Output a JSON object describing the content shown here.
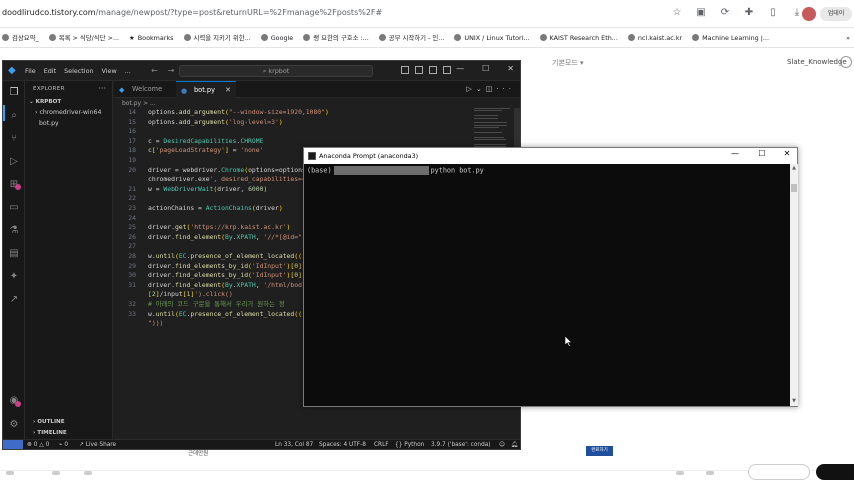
{
  "browser": {
    "url_host": "doodlirudco.tistory.com",
    "url_path": "/manage/newpost/?type=post&returnURL=%2Fmanage%2Fposts%2F#",
    "profile_label": "업데이",
    "bookmarks": [
      "검상요약_",
      "목록 > 식당/식단 >...",
      "Bookmarks",
      "시력을 지키기 위한...",
      "Google",
      "랭 요한의 구호소 :...",
      "공부 시작하기 - 인...",
      "UNIX / Linux Tutori...",
      "KAIST Research Eth...",
      "ncl.kaist.ac.kr",
      "Machine Learning |..."
    ]
  },
  "page": {
    "menu_label": "기본모드 ▾",
    "right_label": "Slate_Knowledge",
    "bottom_label": "근데만원",
    "blue_button": "완료하기"
  },
  "vscode": {
    "menu": [
      "File",
      "Edit",
      "Selection",
      "View",
      "..."
    ],
    "search_text": "krpbot",
    "explorer_title": "EXPLORER",
    "project": "KRPBOT",
    "folder": "chromedriver-win64",
    "file": "bot.py",
    "outline": "OUTLINE",
    "timeline": "TIMELINE",
    "tabs": [
      {
        "label": "Welcome",
        "active": false
      },
      {
        "label": "bot.py",
        "active": true
      }
    ],
    "breadcrumb": "bot.py > ...",
    "status": {
      "errors": "0",
      "warnings": "0",
      "ports": "0",
      "liveshare": "Live Share",
      "position": "Ln 33, Col 87",
      "spaces": "Spaces: 4",
      "encoding": "UTF-8",
      "eol": "CRLF",
      "language": "Python",
      "interpreter": "3.9.7 ('base': conda)"
    }
  },
  "code_lines": [
    {
      "n": "14",
      "text": "options.add_argument(\"--window-size=1920,1080\")"
    },
    {
      "n": "15",
      "text": "options.add_argument('log-level=3')"
    },
    {
      "n": "16",
      "text": ""
    },
    {
      "n": "17",
      "text": "c = DesiredCapabilities.CHROME"
    },
    {
      "n": "18",
      "text": "c['pageLoadStrategy'] = 'none'"
    },
    {
      "n": "19",
      "text": ""
    },
    {
      "n": "20",
      "text": "driver = webdriver.Chrome(options=options"
    },
    {
      "n": "",
      "text": "chromedriver.exe', desired_capabilities=c"
    },
    {
      "n": "21",
      "text": "w = WebDriverWait(driver, 6000)"
    },
    {
      "n": "22",
      "text": ""
    },
    {
      "n": "23",
      "text": "actionChains = ActionChains(driver)"
    },
    {
      "n": "24",
      "text": ""
    },
    {
      "n": "25",
      "text": "driver.get('https://krp.kaist.ac.kr')"
    },
    {
      "n": "26",
      "text": "driver.find_element(By.XPATH, '//*[@id=\""
    },
    {
      "n": "27",
      "text": ""
    },
    {
      "n": "28",
      "text": "w.until(EC.presence_of_element_located(("
    },
    {
      "n": "29",
      "text": "driver.find_elements_by_id('IdInput')[0]"
    },
    {
      "n": "30",
      "text": "driver.find_elements_by_id('IdInput')[0]"
    },
    {
      "n": "31",
      "text": "driver.find_element(By.XPATH, '/html/bod"
    },
    {
      "n": "",
      "text": "[2]/input[1]').click()"
    },
    {
      "n": "32",
      "text": "# 아래의 코드 구문을 통해서 우리가 원하는 정"
    },
    {
      "n": "33",
      "text": "w.until(EC.presence_of_element_located(("
    },
    {
      "n": "",
      "text": "\")))"
    }
  ],
  "anaconda": {
    "title": "Anaconda Prompt (anaconda3)",
    "prompt_prefix": "(base)",
    "command": "python bot.py"
  }
}
